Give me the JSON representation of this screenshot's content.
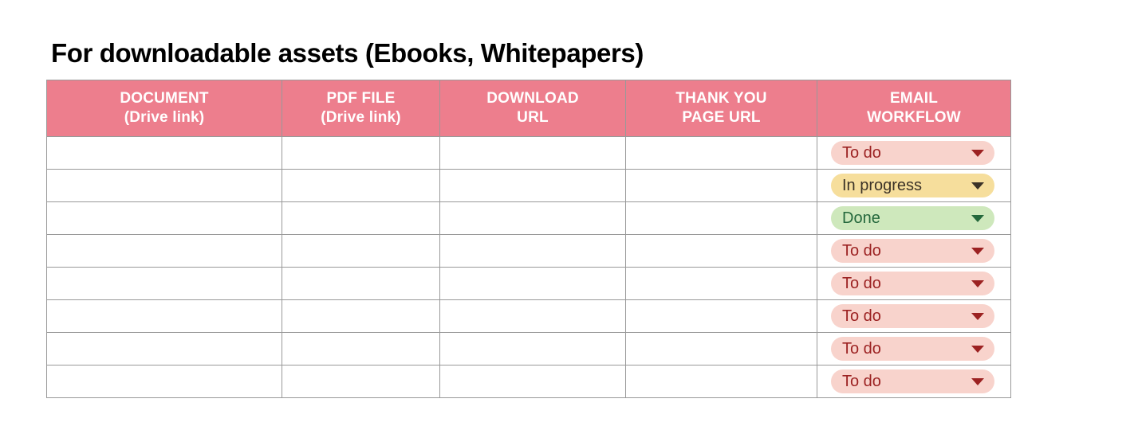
{
  "title": "For downloadable assets (Ebooks, Whitepapers)",
  "table": {
    "columns": [
      {
        "line1": "DOCUMENT",
        "line2": "(Drive link)"
      },
      {
        "line1": "PDF FILE",
        "line2": "(Drive link)"
      },
      {
        "line1": "DOWNLOAD",
        "line2": "URL"
      },
      {
        "line1": "THANK YOU",
        "line2": "PAGE URL"
      },
      {
        "line1": "EMAIL",
        "line2": "WORKFLOW"
      }
    ],
    "rows": [
      {
        "document": "",
        "pdf_file": "",
        "download_url": "",
        "thank_you_page_url": "",
        "email_workflow": "To do"
      },
      {
        "document": "",
        "pdf_file": "",
        "download_url": "",
        "thank_you_page_url": "",
        "email_workflow": "In progress"
      },
      {
        "document": "",
        "pdf_file": "",
        "download_url": "",
        "thank_you_page_url": "",
        "email_workflow": "Done"
      },
      {
        "document": "",
        "pdf_file": "",
        "download_url": "",
        "thank_you_page_url": "",
        "email_workflow": "To do"
      },
      {
        "document": "",
        "pdf_file": "",
        "download_url": "",
        "thank_you_page_url": "",
        "email_workflow": "To do"
      },
      {
        "document": "",
        "pdf_file": "",
        "download_url": "",
        "thank_you_page_url": "",
        "email_workflow": "To do"
      },
      {
        "document": "",
        "pdf_file": "",
        "download_url": "",
        "thank_you_page_url": "",
        "email_workflow": "To do"
      },
      {
        "document": "",
        "pdf_file": "",
        "download_url": "",
        "thank_you_page_url": "",
        "email_workflow": "To do"
      }
    ],
    "status_options": [
      "To do",
      "In progress",
      "Done"
    ],
    "dropdown_icon": "chevron-down-icon"
  },
  "colors": {
    "header_background": "#ED7E8D",
    "header_text": "#FFFFFF",
    "grid_border": "#999999",
    "page_background": "#FFFFFF",
    "title_text": "#000000",
    "status_todo_background": "#F8D3CC",
    "status_todo_text": "#9C2222",
    "status_inprogress_background": "#F6DE9C",
    "status_inprogress_text": "#3B3227",
    "status_done_background": "#CEE8BC",
    "status_done_text": "#24683C"
  }
}
